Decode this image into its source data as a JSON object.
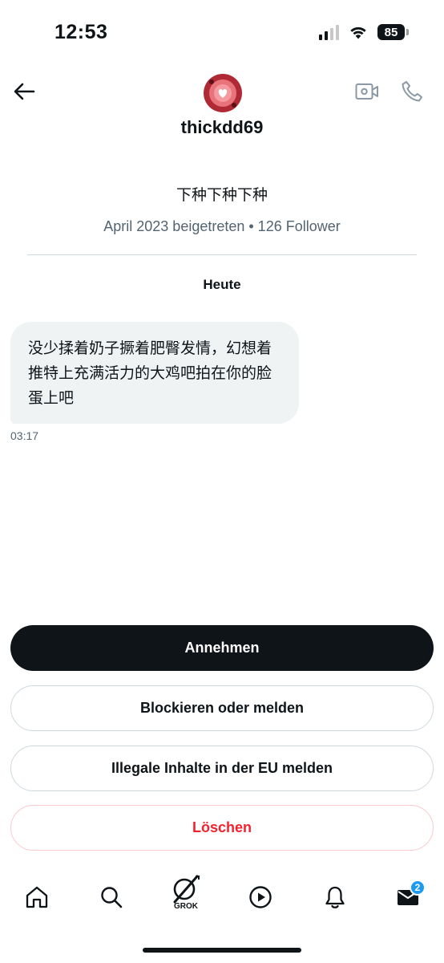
{
  "status_bar": {
    "time": "12:53",
    "battery": "85",
    "icons": [
      "signal-icon",
      "wifi-icon",
      "battery-icon"
    ]
  },
  "header": {
    "username": "thickdd69",
    "icons": [
      "arrow-left-icon",
      "video-icon",
      "phone-icon"
    ]
  },
  "profile": {
    "display_name": "下种下种下种",
    "meta": "April 2023 beigetreten • 126 Follower"
  },
  "conversation": {
    "day_label": "Heute",
    "messages": [
      {
        "text": "没少揉着奶子撅着肥臀发情，幻想着推特上充满活力的大鸡吧拍在你的脸蛋上吧",
        "time": "03:17"
      }
    ]
  },
  "actions": {
    "accept": "Annehmen",
    "block": "Blockieren oder melden",
    "report_eu": "Illegale Inhalte in der EU melden",
    "delete": "Löschen"
  },
  "bottom_nav": {
    "items": [
      "home-icon",
      "search-icon",
      "grok-icon",
      "play-icon",
      "bell-icon",
      "mail-icon"
    ],
    "grok_label": "GROK",
    "mail_badge": "2"
  },
  "colors": {
    "text": "#0f1419",
    "secondary": "#536471",
    "bubble": "#eff3f4",
    "danger": "#f4212e",
    "accent": "#1d9bf0"
  }
}
